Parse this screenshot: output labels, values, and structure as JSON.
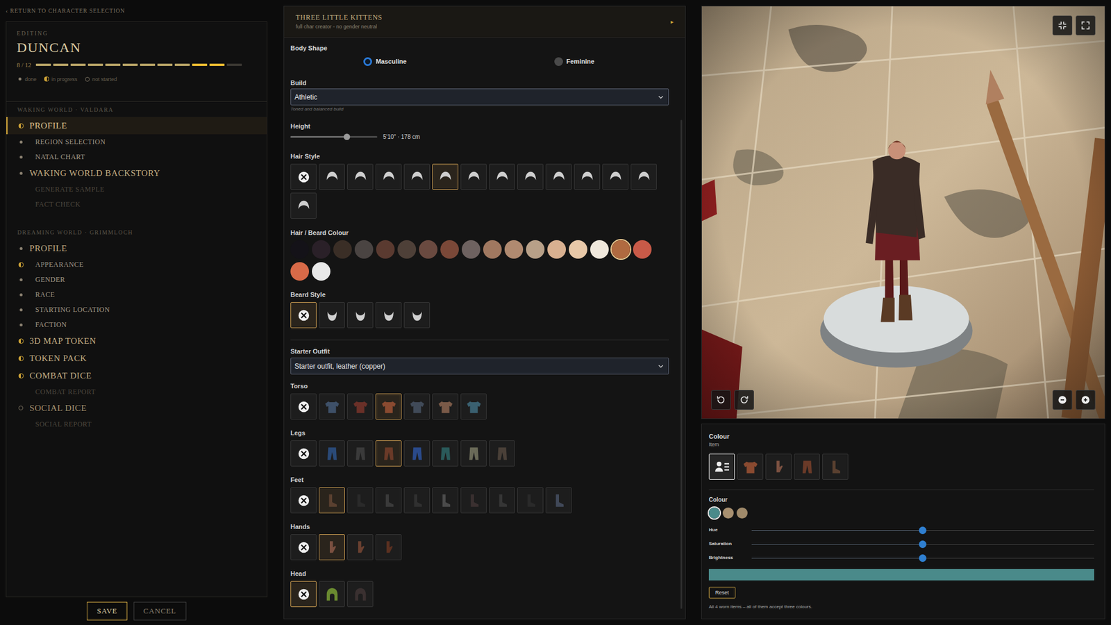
{
  "back_link": "‹ RETURN TO CHARACTER SELECTION",
  "editing": {
    "label": "EDITING",
    "name": "DUNCAN",
    "count": "8 / 12",
    "segments": [
      {
        "status": "done"
      },
      {
        "status": "done"
      },
      {
        "status": "done"
      },
      {
        "status": "done"
      },
      {
        "status": "done"
      },
      {
        "status": "done"
      },
      {
        "status": "done"
      },
      {
        "status": "done"
      },
      {
        "status": "done"
      },
      {
        "status": "in_progress"
      },
      {
        "status": "in_progress"
      },
      {
        "status": "not_started"
      }
    ],
    "legend": [
      {
        "status": "done",
        "label": "done"
      },
      {
        "status": "in_progress",
        "label": "in progress"
      },
      {
        "status": "not_started",
        "label": "not started"
      }
    ]
  },
  "sections": [
    {
      "title": "WAKING WORLD · VALDARA",
      "items": [
        {
          "label": "PROFILE",
          "kind": "top",
          "status": "in_progress",
          "selected": true
        },
        {
          "label": "REGION SELECTION",
          "kind": "sub",
          "status": "done",
          "selected": false
        },
        {
          "label": "NATAL CHART",
          "kind": "sub",
          "status": "done",
          "selected": false
        },
        {
          "label": "WAKING WORLD BACKSTORY",
          "kind": "top",
          "status": "done",
          "selected": false
        },
        {
          "label": "GENERATE SAMPLE",
          "kind": "sub",
          "status": "locked",
          "selected": false
        },
        {
          "label": "FACT CHECK",
          "kind": "sub",
          "status": "locked",
          "selected": false
        }
      ]
    },
    {
      "title": "DREAMING WORLD · GRIMMLOCH",
      "items": [
        {
          "label": "PROFILE",
          "kind": "top",
          "status": "done",
          "selected": false
        },
        {
          "label": "APPEARANCE",
          "kind": "sub",
          "status": "in_progress",
          "selected": false
        },
        {
          "label": "GENDER",
          "kind": "sub",
          "status": "done",
          "selected": false
        },
        {
          "label": "RACE",
          "kind": "sub",
          "status": "done",
          "selected": false
        },
        {
          "label": "STARTING LOCATION",
          "kind": "sub",
          "status": "done",
          "selected": false
        },
        {
          "label": "FACTION",
          "kind": "sub",
          "status": "done",
          "selected": false
        },
        {
          "label": "3D MAP TOKEN",
          "kind": "top",
          "status": "in_progress",
          "selected": false
        },
        {
          "label": "TOKEN PACK",
          "kind": "top",
          "status": "in_progress",
          "selected": false
        },
        {
          "label": "COMBAT DICE",
          "kind": "top",
          "status": "in_progress",
          "selected": false
        },
        {
          "label": "COMBAT REPORT",
          "kind": "sub",
          "status": "locked",
          "selected": false
        },
        {
          "label": "SOCIAL DICE",
          "kind": "top",
          "status": "not_started",
          "selected": false
        },
        {
          "label": "SOCIAL REPORT",
          "kind": "sub",
          "status": "locked",
          "selected": false
        }
      ]
    }
  ],
  "footer_buttons": [
    {
      "label": "SAVE"
    },
    {
      "label": "CANCEL"
    }
  ],
  "creator": {
    "title": "THREE LITTLE KITTENS",
    "subtitle": "full char creator - no gender neutral",
    "toggle": "▸",
    "body_shape": {
      "label": "Body Shape",
      "options": [
        {
          "label": "Masculine",
          "selected": true
        },
        {
          "label": "Feminine",
          "selected": false
        }
      ]
    },
    "build": {
      "label": "Build",
      "value": "Athletic",
      "hint": "Toned and balanced build"
    },
    "height": {
      "label": "Height",
      "level": 0.65,
      "reading": "5'10\" · 178 cm"
    },
    "hair_style": {
      "label": "Hair Style",
      "kind": "hair",
      "options": [
        {
          "kind": "none",
          "selected": false
        },
        {
          "kind": "item",
          "selected": false
        },
        {
          "kind": "item",
          "selected": false
        },
        {
          "kind": "item",
          "selected": false
        },
        {
          "kind": "item",
          "selected": false
        },
        {
          "kind": "item",
          "selected": true
        },
        {
          "kind": "item",
          "selected": false
        },
        {
          "kind": "item",
          "selected": false
        },
        {
          "kind": "item",
          "selected": false
        },
        {
          "kind": "item",
          "selected": false
        },
        {
          "kind": "item",
          "selected": false
        },
        {
          "kind": "item",
          "selected": false
        },
        {
          "kind": "item",
          "selected": false
        },
        {
          "kind": "item",
          "selected": false
        }
      ]
    },
    "hair_colour": {
      "label": "Hair / Beard Colour",
      "swatches": [
        {
          "color": "#141218",
          "selected": false
        },
        {
          "color": "#2a2028",
          "selected": false
        },
        {
          "color": "#3a2e26",
          "selected": false
        },
        {
          "color": "#4a4442",
          "selected": false
        },
        {
          "color": "#5a3a30",
          "selected": false
        },
        {
          "color": "#4e4038",
          "selected": false
        },
        {
          "color": "#6a4a40",
          "selected": false
        },
        {
          "color": "#7a4838",
          "selected": false
        },
        {
          "color": "#6e6260",
          "selected": false
        },
        {
          "color": "#a07860",
          "selected": false
        },
        {
          "color": "#b08a70",
          "selected": false
        },
        {
          "color": "#b8a088",
          "selected": false
        },
        {
          "color": "#d8b090",
          "selected": false
        },
        {
          "color": "#e8c8a8",
          "selected": false
        },
        {
          "color": "#efe8dc",
          "selected": false
        },
        {
          "color": "#b06a40",
          "selected": true
        },
        {
          "color": "#c85a48",
          "selected": false
        },
        {
          "color": "#d86a48",
          "selected": false
        },
        {
          "color": "#e8e8e8",
          "selected": false
        }
      ]
    },
    "beard_style": {
      "label": "Beard Style",
      "kind": "beard",
      "options": [
        {
          "kind": "none",
          "selected": true
        },
        {
          "kind": "item",
          "selected": false
        },
        {
          "kind": "item",
          "selected": false
        },
        {
          "kind": "item",
          "selected": false
        },
        {
          "kind": "item",
          "selected": false
        }
      ]
    },
    "starter_outfit": {
      "label": "Starter Outfit",
      "value": "Starter outfit, leather (copper)"
    },
    "slots": [
      {
        "label": "Torso",
        "kind": "torso",
        "options": [
          {
            "kind": "none",
            "selected": false
          },
          {
            "kind": "item",
            "color": "#3e5068",
            "selected": false
          },
          {
            "kind": "item",
            "color": "#6a3028",
            "selected": false
          },
          {
            "kind": "item",
            "color": "#8a4a30",
            "selected": true
          },
          {
            "kind": "item",
            "color": "#404a58",
            "selected": false
          },
          {
            "kind": "item",
            "color": "#7a5a48",
            "selected": false
          },
          {
            "kind": "item",
            "color": "#3a6070",
            "selected": false
          }
        ]
      },
      {
        "label": "Legs",
        "kind": "legs",
        "options": [
          {
            "kind": "none",
            "selected": false
          },
          {
            "kind": "item",
            "color": "#2a4a78",
            "selected": false
          },
          {
            "kind": "item",
            "color": "#3a3a3a",
            "selected": false
          },
          {
            "kind": "item",
            "color": "#6a3a28",
            "selected": true
          },
          {
            "kind": "item",
            "color": "#2a4a8a",
            "selected": false
          },
          {
            "kind": "item",
            "color": "#2a5a5a",
            "selected": false
          },
          {
            "kind": "item",
            "color": "#6a6a58",
            "selected": false
          },
          {
            "kind": "item",
            "color": "#4a4038",
            "selected": false
          }
        ]
      },
      {
        "label": "Feet",
        "kind": "feet",
        "options": [
          {
            "kind": "none",
            "selected": false
          },
          {
            "kind": "item",
            "color": "#5a4030",
            "selected": true
          },
          {
            "kind": "item",
            "color": "#2a2a2a",
            "selected": false
          },
          {
            "kind": "item",
            "color": "#3a3a3a",
            "selected": false
          },
          {
            "kind": "item",
            "color": "#303030",
            "selected": false
          },
          {
            "kind": "item",
            "color": "#4a4a4a",
            "selected": false
          },
          {
            "kind": "item",
            "color": "#3a3030",
            "selected": false
          },
          {
            "kind": "item",
            "color": "#353535",
            "selected": false
          },
          {
            "kind": "item",
            "color": "#2a2a2a",
            "selected": false
          },
          {
            "kind": "item",
            "color": "#404858",
            "selected": false
          }
        ]
      },
      {
        "label": "Hands",
        "kind": "hands",
        "options": [
          {
            "kind": "none",
            "selected": false
          },
          {
            "kind": "item",
            "color": "#7a5040",
            "selected": true
          },
          {
            "kind": "item",
            "color": "#6a4030",
            "selected": false
          },
          {
            "kind": "item",
            "color": "#5a3020",
            "selected": false
          }
        ]
      },
      {
        "label": "Head",
        "kind": "head",
        "options": [
          {
            "kind": "none",
            "selected": true
          },
          {
            "kind": "item",
            "color": "#6a8a30",
            "selected": false
          },
          {
            "kind": "item",
            "color": "#3a3030",
            "selected": false
          }
        ]
      }
    ]
  },
  "colour_panel": {
    "title": "Colour",
    "item_label": "Item",
    "items": [
      {
        "kind": "all",
        "selected": true
      },
      {
        "kind": "torso",
        "color": "#8a4a30",
        "selected": false
      },
      {
        "kind": "hands",
        "color": "#7a5040",
        "selected": false
      },
      {
        "kind": "legs",
        "color": "#6a3a28",
        "selected": false
      },
      {
        "kind": "feet",
        "color": "#5a4030",
        "selected": false
      }
    ],
    "colour_label": "Colour",
    "swatches": [
      {
        "color": "#4a8a8a",
        "selected": true
      },
      {
        "color": "#a89070",
        "selected": false
      },
      {
        "color": "#a08a6a",
        "selected": false
      }
    ],
    "sliders": [
      {
        "label": "Hue",
        "level": 0.5
      },
      {
        "label": "Saturation",
        "level": 0.5
      },
      {
        "label": "Brightness",
        "level": 0.5
      }
    ],
    "reset": "Reset",
    "note": "All 4 worn items – all of them accept three colours."
  }
}
